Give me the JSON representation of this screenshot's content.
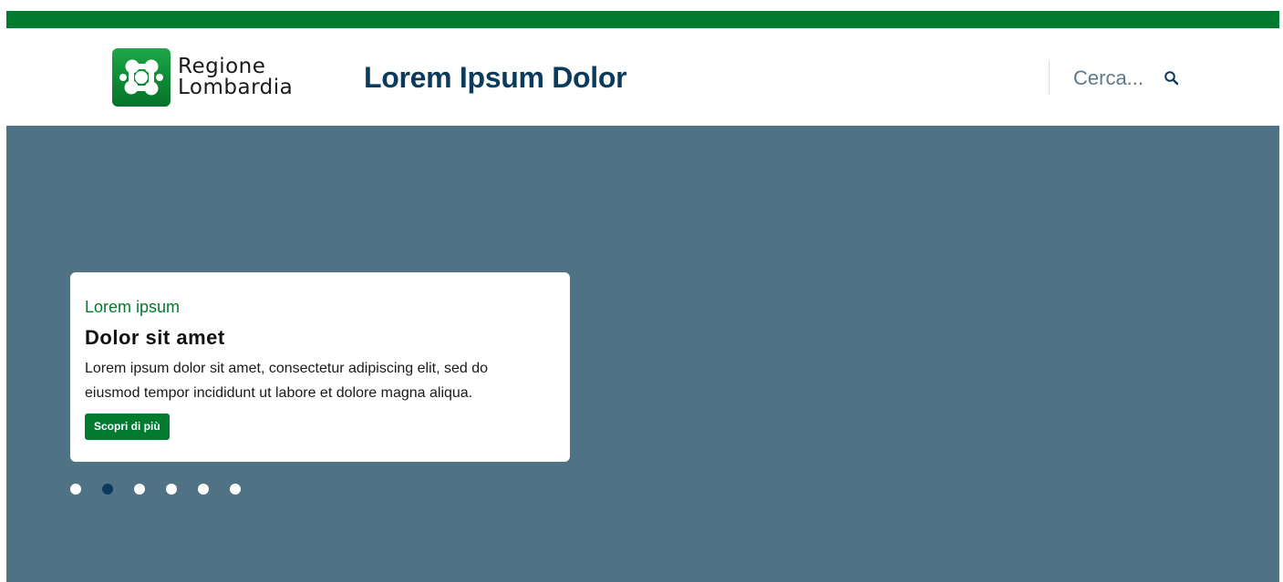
{
  "brand": {
    "logo_line1": "Regione",
    "logo_line2": "Lombardia",
    "site_title": "Lorem Ipsum Dolor",
    "colors": {
      "green": "#007a2f",
      "navy": "#0a3a5c",
      "hero_bg": "#4f7384"
    }
  },
  "search": {
    "placeholder": "Cerca...",
    "icon": "search-icon"
  },
  "hero": {
    "card": {
      "kicker": "Lorem ipsum",
      "title": "Dolor sit amet",
      "body": "Lorem ipsum dolor sit amet, consectetur adipiscing elit, sed do eiusmod tempor incididunt ut labore et dolore magna aliqua.",
      "cta_label": "Scopri di più"
    },
    "carousel": {
      "total_slides": 6,
      "active_index": 1
    }
  }
}
